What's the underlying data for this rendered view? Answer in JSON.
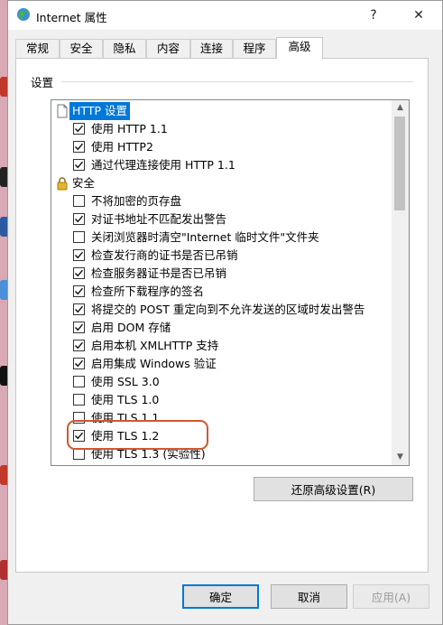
{
  "window": {
    "title": "Internet 属性",
    "help_glyph": "?",
    "close_glyph": "✕"
  },
  "tabs": [
    {
      "label": "常规"
    },
    {
      "label": "安全"
    },
    {
      "label": "隐私"
    },
    {
      "label": "内容"
    },
    {
      "label": "连接"
    },
    {
      "label": "程序"
    },
    {
      "label": "高级",
      "active": true
    }
  ],
  "settings": {
    "group_label": "设置",
    "items": [
      {
        "type": "category",
        "icon": "page-icon",
        "label": "HTTP 设置",
        "selected": true
      },
      {
        "type": "checkbox",
        "label": "使用 HTTP 1.1",
        "checked": true
      },
      {
        "type": "checkbox",
        "label": "使用 HTTP2",
        "checked": true
      },
      {
        "type": "checkbox",
        "label": "通过代理连接使用 HTTP 1.1",
        "checked": true
      },
      {
        "type": "category",
        "icon": "lock-icon",
        "label": "安全"
      },
      {
        "type": "checkbox",
        "label": "不将加密的页存盘",
        "checked": false
      },
      {
        "type": "checkbox",
        "label": "对证书地址不匹配发出警告",
        "checked": true
      },
      {
        "type": "checkbox",
        "label": "关闭浏览器时清空\"Internet 临时文件\"文件夹",
        "checked": false
      },
      {
        "type": "checkbox",
        "label": "检查发行商的证书是否已吊销",
        "checked": true
      },
      {
        "type": "checkbox",
        "label": "检查服务器证书是否已吊销",
        "checked": true
      },
      {
        "type": "checkbox",
        "label": "检查所下载程序的签名",
        "checked": true
      },
      {
        "type": "checkbox",
        "label": "将提交的 POST 重定向到不允许发送的区域时发出警告",
        "checked": true
      },
      {
        "type": "checkbox",
        "label": "启用 DOM 存储",
        "checked": true
      },
      {
        "type": "checkbox",
        "label": "启用本机 XMLHTTP 支持",
        "checked": true
      },
      {
        "type": "checkbox",
        "label": "启用集成 Windows 验证",
        "checked": true
      },
      {
        "type": "checkbox",
        "label": "使用 SSL 3.0",
        "checked": false
      },
      {
        "type": "checkbox",
        "label": "使用 TLS 1.0",
        "checked": false
      },
      {
        "type": "checkbox",
        "label": "使用 TLS 1.1",
        "checked": false
      },
      {
        "type": "checkbox",
        "label": "使用 TLS 1.2",
        "checked": true
      },
      {
        "type": "checkbox",
        "label": "使用 TLS 1.3 (实验性)",
        "checked": false
      }
    ]
  },
  "restore_button": "还原高级设置(R)",
  "footer": {
    "ok": "确定",
    "cancel": "取消",
    "apply": "应用(A)"
  },
  "colors": {
    "accent": "#0078d7",
    "highlight_ring": "#d2572f"
  }
}
